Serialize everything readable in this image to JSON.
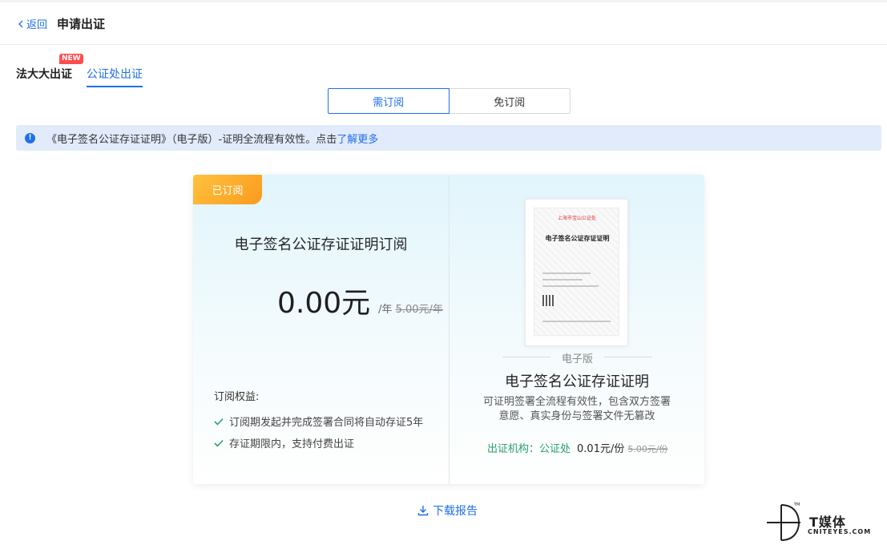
{
  "header": {
    "back_label": "返回",
    "title": "申请出证"
  },
  "tabs": [
    {
      "label": "法大大出证",
      "badge": "NEW"
    },
    {
      "label": "公证处出证"
    }
  ],
  "segment": {
    "options": [
      "需订阅",
      "免订阅"
    ],
    "selected": "需订阅"
  },
  "alert": {
    "text": "《电子签名公证存证证明》（电子版）-证明全流程有效性。点击",
    "link": "了解更多"
  },
  "plan_card": {
    "ribbon": "已订阅",
    "title": "电子签名公证存证证明订阅",
    "price": "0.00元",
    "unit": "/年",
    "original_price": "5.00元/年",
    "benefits_title": "订阅权益:",
    "benefits": [
      "订阅期发起并完成签署合同将自动存证5年",
      "存证期限内，支持付费出证"
    ]
  },
  "product_card": {
    "doc_header": "上海市宝山公证处",
    "doc_title": "电子签名公证存证证明",
    "edition": "电子版",
    "title": "电子签名公证存证证明",
    "description": "可证明签署全流程有效性，包含双方签署意愿、真实身份与签署文件无篡改",
    "issuer": "出证机构：公证处",
    "price": "0.01元/份",
    "original_price": "5.00元/份"
  },
  "download_label": "下载报告",
  "watermark": {
    "brand": "T媒体",
    "sub": "CNITEYES.COM"
  },
  "colors": {
    "primary": "#1f6feb",
    "success": "#27a16a",
    "ribbon": "#fa9a1e",
    "badge": "#ff4d4f"
  }
}
